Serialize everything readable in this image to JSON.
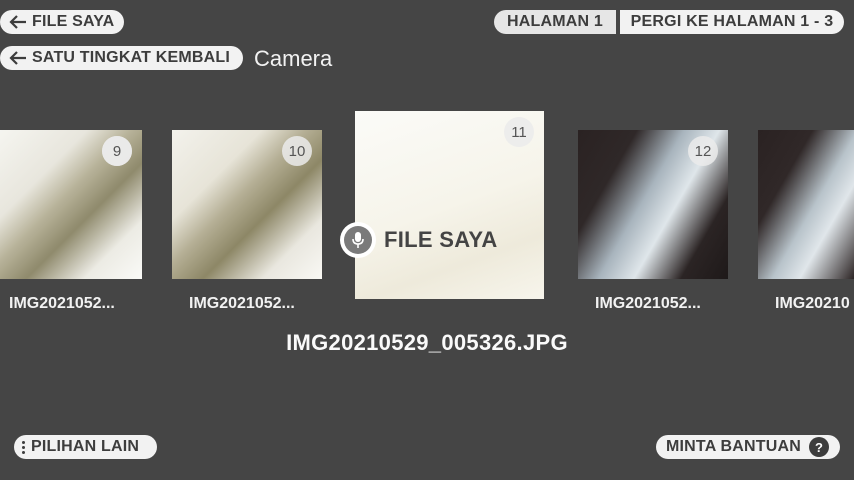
{
  "header": {
    "file_saya_label": "FILE SAYA",
    "back_label": "SATU TINGKAT KEMBALI",
    "folder_name": "Camera",
    "page_indicator": "HALAMAN 1",
    "goto_page_label": "PERGI KE HALAMAN 1 - 3"
  },
  "gallery": {
    "items": [
      {
        "number": "9",
        "caption": "IMG2021052..."
      },
      {
        "number": "10",
        "caption": "IMG2021052..."
      },
      {
        "number": "11",
        "caption": ""
      },
      {
        "number": "12",
        "caption": "IMG2021052..."
      },
      {
        "number": "",
        "caption": "IMG20210"
      }
    ],
    "selected_title": "IMG20210529_005326.JPG",
    "voice_label": "FILE SAYA"
  },
  "footer": {
    "more_options_label": "PILIHAN LAIN",
    "help_label": "MINTA BANTUAN",
    "help_icon_glyph": "?"
  },
  "colors": {
    "background": "#454545",
    "pill": "#f2f2f2",
    "pill_text": "#3d3d3d"
  },
  "icons": [
    "arrow-left-icon",
    "microphone-icon",
    "more-vertical-icon",
    "help-icon"
  ]
}
